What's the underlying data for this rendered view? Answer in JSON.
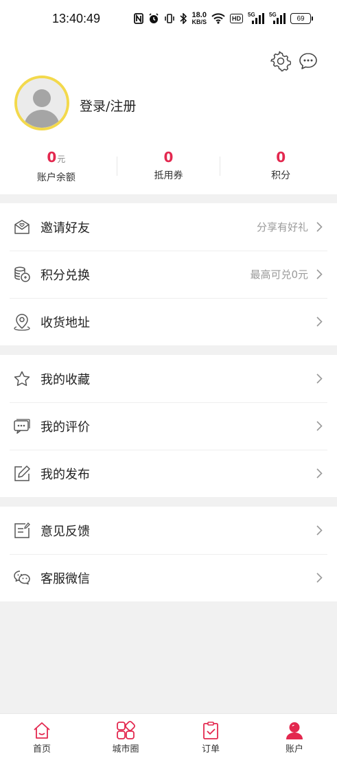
{
  "status_bar": {
    "time": "13:40:49",
    "speed_value": "18.0",
    "speed_unit": "KB/S",
    "hd": "HD",
    "sim1": "5G",
    "sim2": "5G",
    "battery": "69"
  },
  "profile": {
    "login_label": "登录/注册",
    "stats": [
      {
        "value": "0",
        "unit": "元",
        "label": "账户余额"
      },
      {
        "value": "0",
        "unit": "",
        "label": "抵用券"
      },
      {
        "value": "0",
        "unit": "",
        "label": "积分"
      }
    ]
  },
  "menu": {
    "group1": [
      {
        "icon": "invite-mail-icon",
        "label": "邀请好友",
        "hint": "分享有好礼"
      },
      {
        "icon": "points-coins-icon",
        "label": "积分兑换",
        "hint": "最高可兑0元"
      },
      {
        "icon": "location-pin-icon",
        "label": "收货地址",
        "hint": ""
      }
    ],
    "group2": [
      {
        "icon": "star-icon",
        "label": "我的收藏",
        "hint": ""
      },
      {
        "icon": "comment-icon",
        "label": "我的评价",
        "hint": ""
      },
      {
        "icon": "edit-icon",
        "label": "我的发布",
        "hint": ""
      }
    ],
    "group3": [
      {
        "icon": "feedback-icon",
        "label": "意见反馈",
        "hint": ""
      },
      {
        "icon": "wechat-icon",
        "label": "客服微信",
        "hint": ""
      }
    ]
  },
  "tabbar": [
    {
      "icon": "home-icon",
      "label": "首页",
      "active": false
    },
    {
      "icon": "city-circle-icon",
      "label": "城市圈",
      "active": false
    },
    {
      "icon": "order-icon",
      "label": "订单",
      "active": false
    },
    {
      "icon": "account-icon",
      "label": "账户",
      "active": true
    }
  ],
  "colors": {
    "accent": "#e3284f",
    "avatar_ring": "#f3d94c",
    "background": "#f1f1f1"
  }
}
